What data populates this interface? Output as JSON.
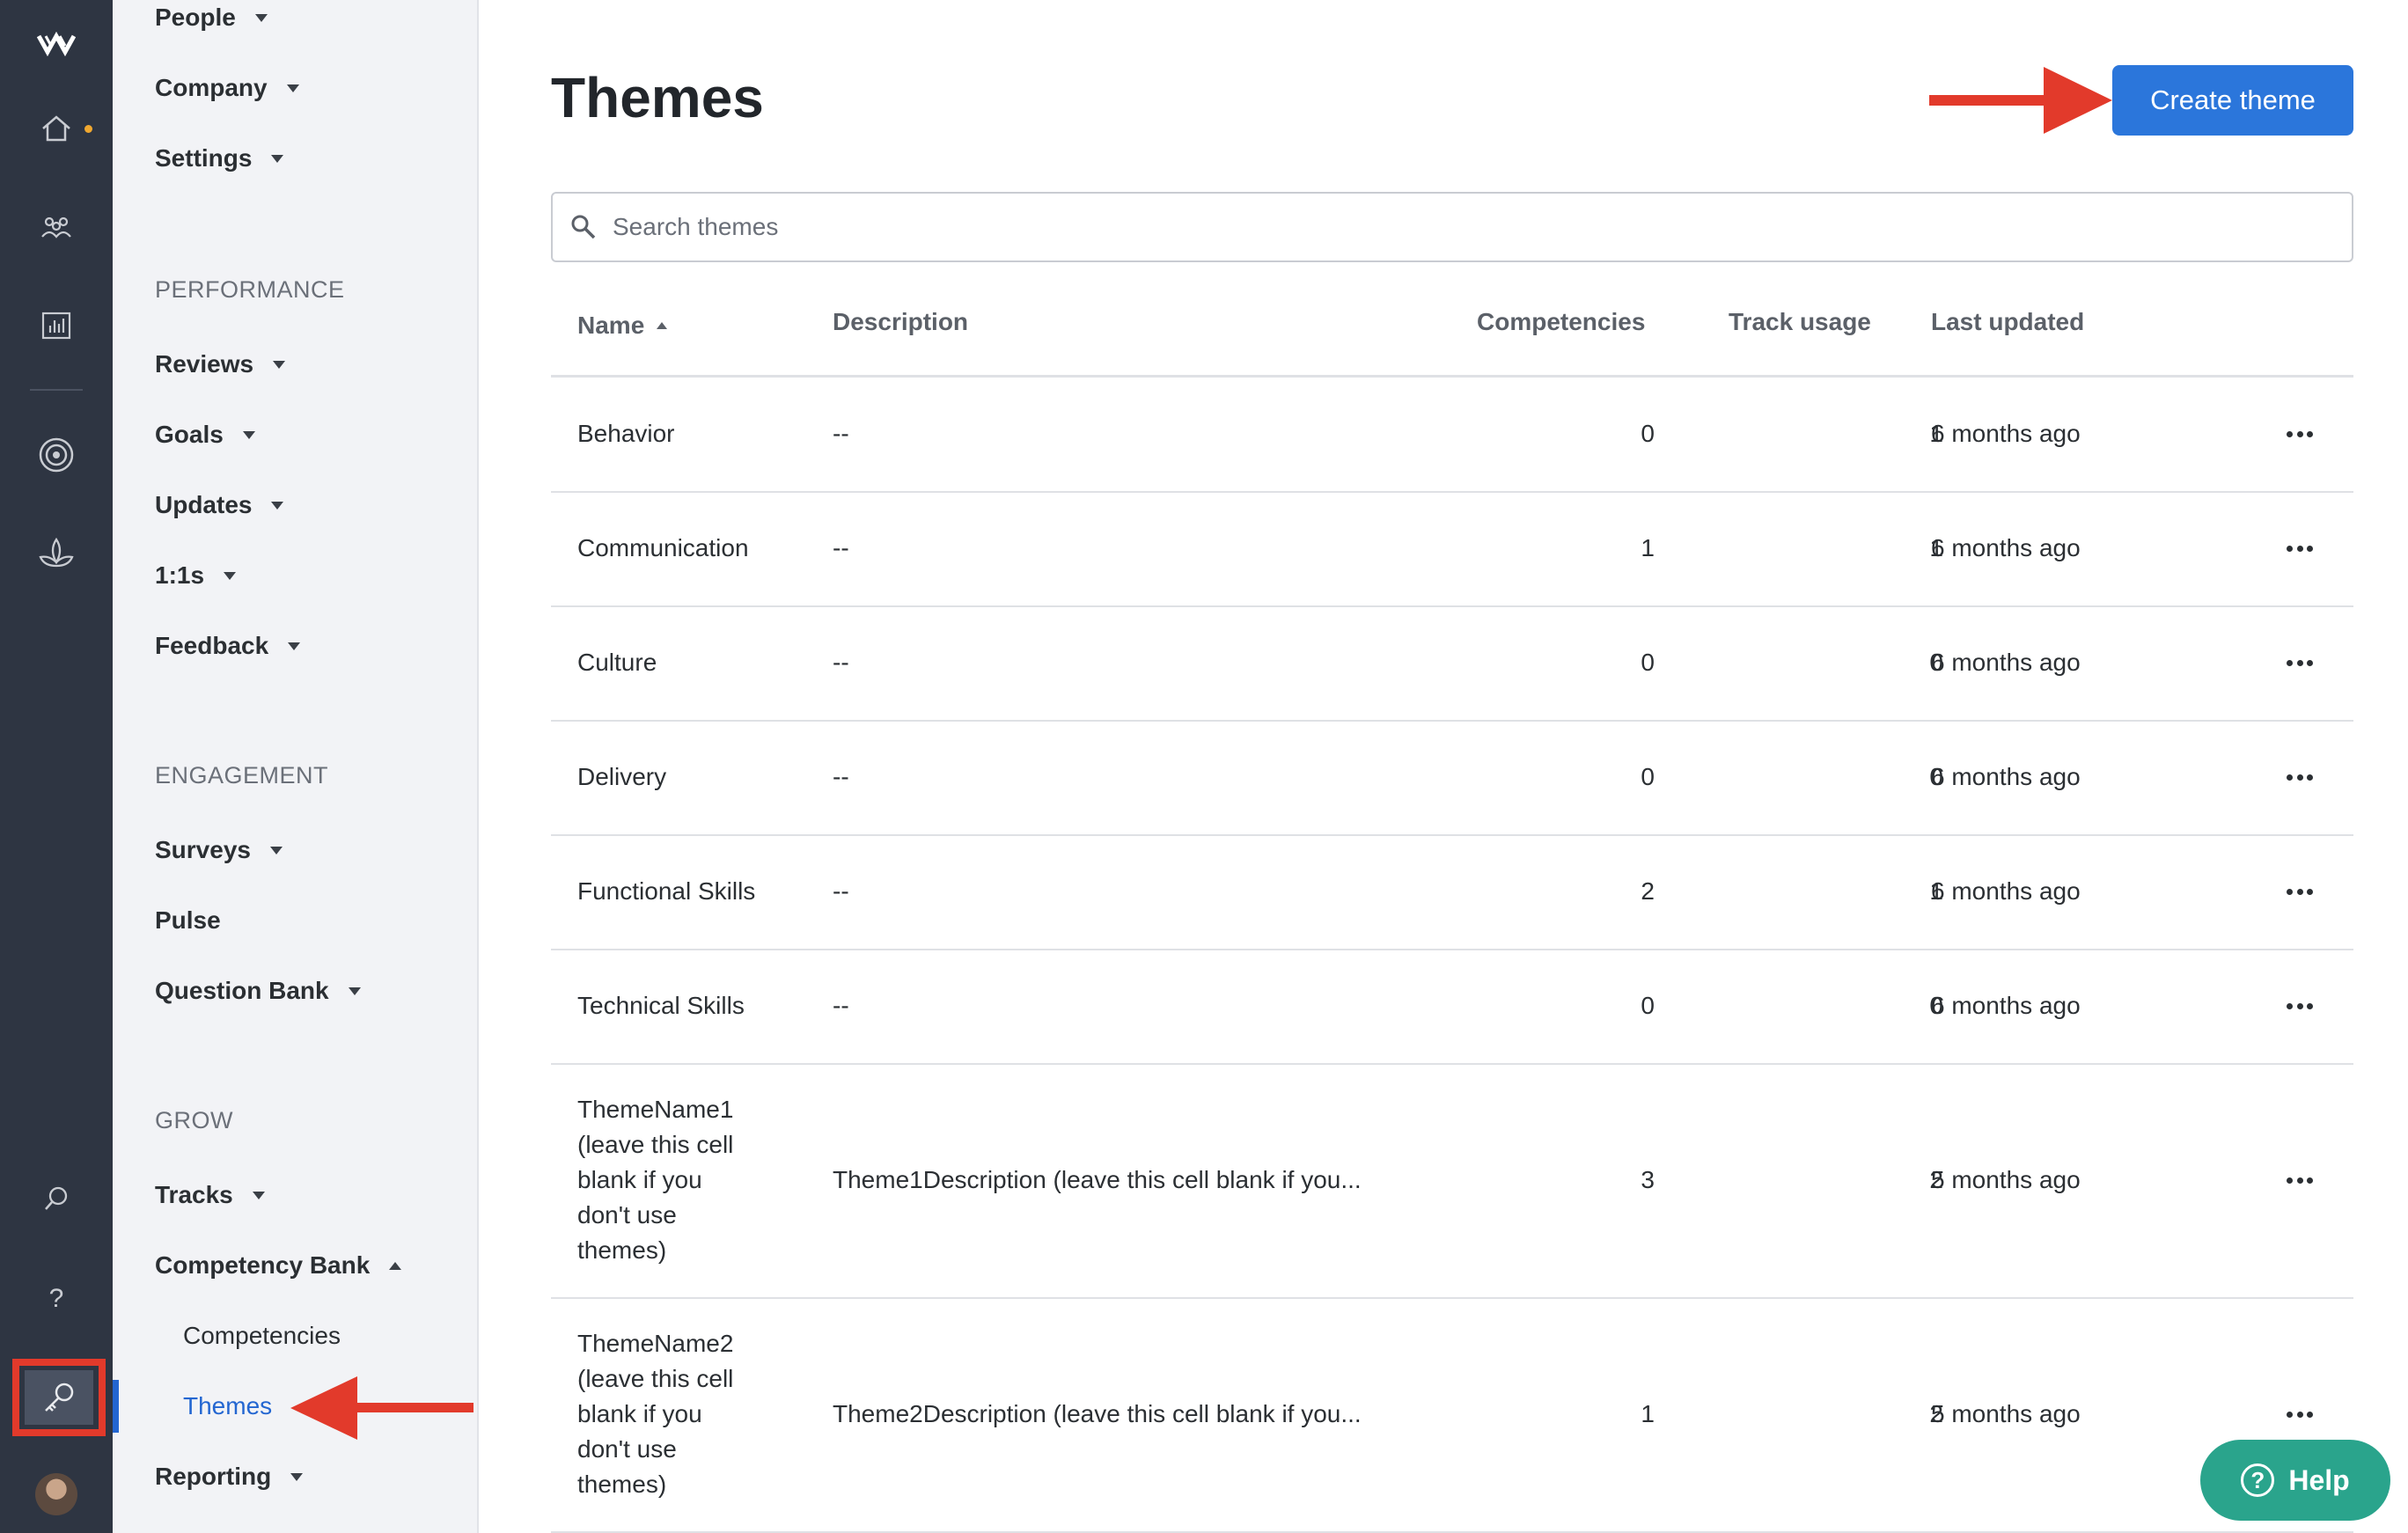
{
  "colors": {
    "accent": "#2b76db",
    "annotation": "#e23a2b",
    "help": "#2aa48c",
    "rail": "#2e3542"
  },
  "rail": {
    "icons": [
      "logo-icon",
      "home-icon",
      "people-icon",
      "chart-icon",
      "target-icon",
      "lotus-icon",
      "search-icon",
      "help-icon",
      "key-icon",
      "avatar"
    ]
  },
  "nav": {
    "top_items": [
      "People",
      "Company",
      "Settings"
    ],
    "performance": {
      "heading": "PERFORMANCE",
      "items": [
        "Reviews",
        "Goals",
        "Updates",
        "1:1s",
        "Feedback"
      ]
    },
    "engagement": {
      "heading": "ENGAGEMENT",
      "items": [
        "Surveys",
        "Pulse",
        "Question Bank"
      ]
    },
    "grow": {
      "heading": "GROW",
      "items": [
        "Tracks",
        "Competency Bank"
      ],
      "sub_items": [
        "Competencies",
        "Themes"
      ]
    },
    "reporting": "Reporting"
  },
  "page": {
    "title": "Themes",
    "create_label": "Create theme"
  },
  "search": {
    "placeholder": "Search themes",
    "value": ""
  },
  "table": {
    "columns": [
      "Name",
      "Description",
      "Competencies",
      "Track usage",
      "Last updated"
    ],
    "rows": [
      {
        "name": [
          "Behavior"
        ],
        "description": "--",
        "competencies": "0",
        "track_usage": "1",
        "last_updated": "6 months ago"
      },
      {
        "name": [
          "Communication"
        ],
        "description": "--",
        "competencies": "1",
        "track_usage": "1",
        "last_updated": "6 months ago"
      },
      {
        "name": [
          "Culture"
        ],
        "description": "--",
        "competencies": "0",
        "track_usage": "0",
        "last_updated": "6 months ago"
      },
      {
        "name": [
          "Delivery"
        ],
        "description": "--",
        "competencies": "0",
        "track_usage": "0",
        "last_updated": "6 months ago"
      },
      {
        "name": [
          "Functional Skills"
        ],
        "description": "--",
        "competencies": "2",
        "track_usage": "1",
        "last_updated": "6 months ago"
      },
      {
        "name": [
          "Technical Skills"
        ],
        "description": "--",
        "competencies": "0",
        "track_usage": "0",
        "last_updated": "6 months ago"
      },
      {
        "name": [
          "ThemeName1",
          "(leave this cell",
          "blank if you",
          "don't use",
          "themes)"
        ],
        "description": "Theme1Description (leave this cell blank if you...",
        "competencies": "3",
        "track_usage": "2",
        "last_updated": "5 months ago"
      },
      {
        "name": [
          "ThemeName2",
          "(leave this cell",
          "blank if you",
          "don't use",
          "themes)"
        ],
        "description": "Theme2Description (leave this cell blank if you...",
        "competencies": "1",
        "track_usage": "2",
        "last_updated": "5 months ago"
      }
    ]
  },
  "help": {
    "label": "Help"
  }
}
